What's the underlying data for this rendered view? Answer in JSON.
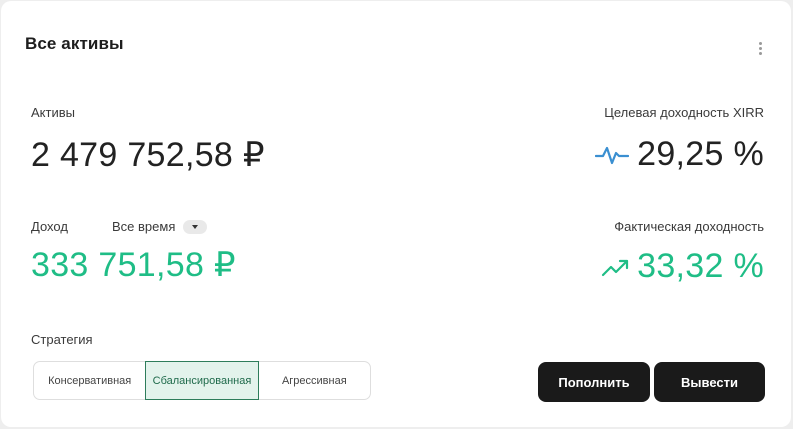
{
  "card": {
    "title": "Все активы"
  },
  "assets": {
    "label": "Активы",
    "value": "2 479 752,58 ₽"
  },
  "target_yield": {
    "label": "Целевая доходность XIRR",
    "value": "29,25 %",
    "icon": "pulse-icon",
    "icon_color": "#3a8fd1"
  },
  "income": {
    "label": "Доход",
    "period": "Все время",
    "value": "333 751,58 ₽",
    "color": "#1fbd86"
  },
  "actual_yield": {
    "label": "Фактическая доходность",
    "value": "33,32 %",
    "icon": "trending-up-icon",
    "color": "#1fbd86"
  },
  "strategy": {
    "label": "Стратегия",
    "options": [
      "Консервативная",
      "Сбалансированная",
      "Агрессивная"
    ],
    "selected": "Сбалансированная"
  },
  "actions": {
    "topup_label": "Пополнить",
    "withdraw_label": "Вывести"
  }
}
